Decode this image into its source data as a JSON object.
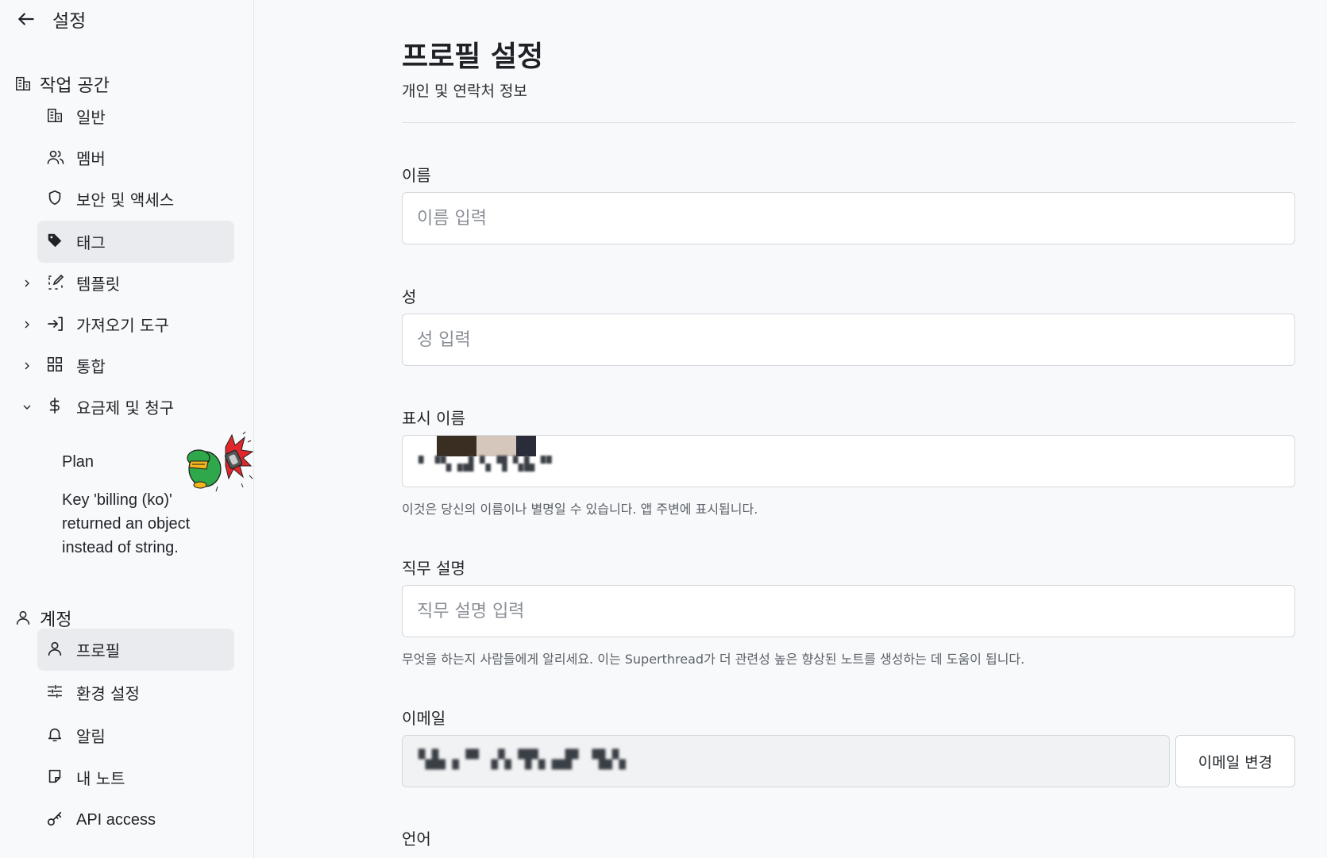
{
  "sidebar": {
    "title": "설정",
    "workspace_section": "작업 공간",
    "items": [
      {
        "label": "일반"
      },
      {
        "label": "멤버"
      },
      {
        "label": "보안 및 액세스"
      },
      {
        "label": "태그"
      },
      {
        "label": "템플릿"
      },
      {
        "label": "가져오기 도구"
      },
      {
        "label": "통합"
      },
      {
        "label": "요금제 및 청구"
      }
    ],
    "billing_sub": {
      "plan": "Plan",
      "error_line1": "Key 'billing (ko)'",
      "error_line2": "returned an object",
      "error_line3": "instead of string."
    },
    "account_section": "계정",
    "account_items": [
      {
        "label": "프로필"
      },
      {
        "label": "환경 설정"
      },
      {
        "label": "알림"
      },
      {
        "label": "내 노트"
      },
      {
        "label": "API access"
      }
    ],
    "active_item": "태그",
    "active_account_item": "프로필"
  },
  "main": {
    "title": "프로필 설정",
    "subtitle": "개인 및 연락처 정보",
    "fields": {
      "first_name": {
        "label": "이름",
        "placeholder": "이름 입력",
        "value": ""
      },
      "last_name": {
        "label": "성",
        "placeholder": "성 입력",
        "value": ""
      },
      "display_name": {
        "label": "표시 이름",
        "hint": "이것은 당신의 이름이나 별명일 수 있습니다. 앱 주변에 표시됩니다."
      },
      "job": {
        "label": "직무 설명",
        "placeholder": "직무 설명 입력",
        "hint": "무엇을 하는지 사람들에게 알리세요. 이는 Superthread가 더 관련성 높은 향상된 노트를 생성하는 데 도움이 됩니다."
      },
      "email": {
        "label": "이메일",
        "button": "이메일 변경"
      },
      "language": {
        "label": "언어"
      }
    }
  },
  "icons": [
    "back-arrow-icon",
    "building-icon",
    "users-icon",
    "shield-icon",
    "tag-icon",
    "template-icon",
    "import-icon",
    "grid-icon",
    "dollar-icon",
    "user-icon",
    "sliders-icon",
    "bell-icon",
    "note-icon",
    "key-icon",
    "chevron-right-icon",
    "chevron-down-icon"
  ],
  "colors": {
    "active_bg": "#e9ebee",
    "text": "#1f2328",
    "border": "#d5d8dc",
    "background": "#f8f9fa"
  }
}
